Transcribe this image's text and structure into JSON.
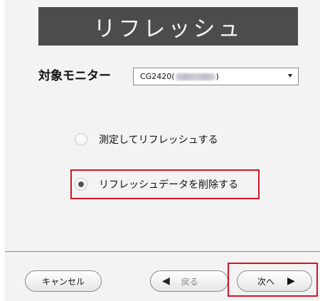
{
  "header": {
    "title": "リフレッシュ"
  },
  "monitor": {
    "label": "対象モニター",
    "selected_prefix": "CG2420(",
    "selected_suffix": ")"
  },
  "options": [
    {
      "label": "測定してリフレッシュする",
      "checked": false
    },
    {
      "label": "リフレッシュデータを削除する",
      "checked": true
    }
  ],
  "footer": {
    "cancel_label": "キャンセル",
    "back_label": "戻る",
    "back_arrow": "◀",
    "next_label": "次へ",
    "next_arrow": "▶"
  },
  "colors": {
    "title_bg": "#4c4c4c",
    "highlight": "#d4142a",
    "window_bg": "#f3f3f3"
  },
  "icons": {
    "back": "triangle-left-icon",
    "next": "triangle-right-icon",
    "dropdown": "chevron-down-icon"
  }
}
